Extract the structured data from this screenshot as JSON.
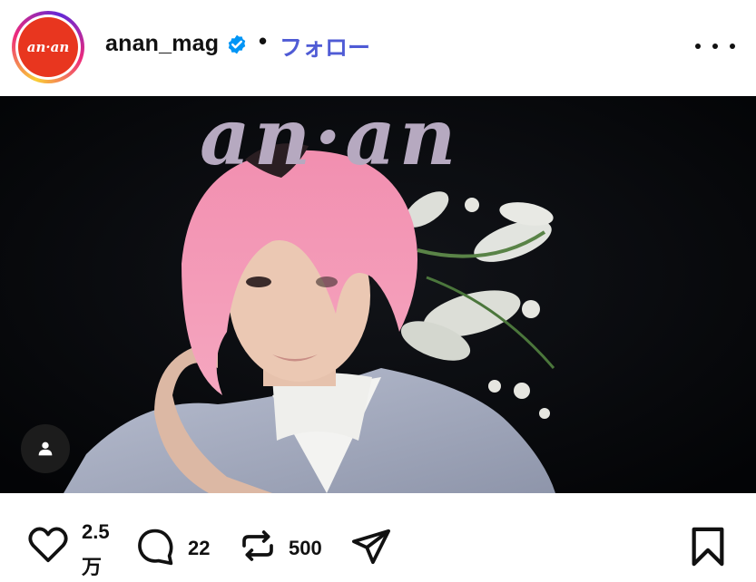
{
  "post": {
    "account": {
      "username": "anan_mag",
      "avatar_text": "an·an",
      "verified_icon": "verified-badge-icon",
      "separator": "•",
      "follow_label": "フォロー"
    },
    "menu_icon": "more-options-icon",
    "media": {
      "logo_text": "an·an",
      "user_tag_icon": "person-icon"
    },
    "actions": {
      "like_count_line1": "2.5",
      "like_count_line2": "万",
      "comment_count": "22",
      "repost_count": "500",
      "icons": [
        "heart-icon",
        "comment-icon",
        "repost-icon",
        "share-icon",
        "bookmark-icon"
      ]
    }
  },
  "colors": {
    "follow_blue": "#4f5bd5",
    "verified_blue": "#0095f6",
    "avatar_red": "#e8361f",
    "media_background": "#050608"
  }
}
